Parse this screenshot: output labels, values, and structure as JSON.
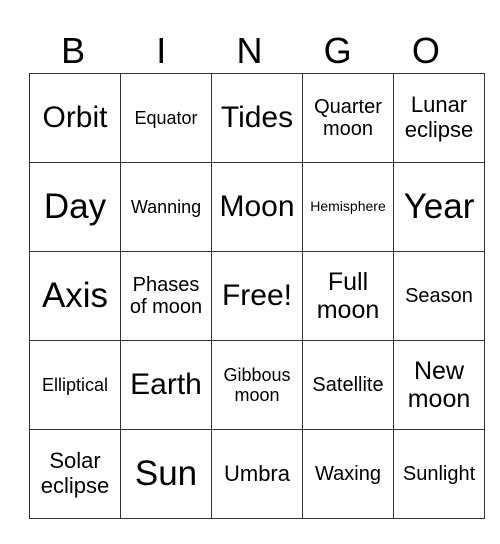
{
  "header": [
    "B",
    "I",
    "N",
    "G",
    "O"
  ],
  "rows": [
    [
      "Orbit",
      "Equator",
      "Tides",
      "Quarter moon",
      "Lunar eclipse"
    ],
    [
      "Day",
      "Wanning",
      "Moon",
      "Hemisphere",
      "Year"
    ],
    [
      "Axis",
      "Phases of moon",
      "Free!",
      "Full moon",
      "Season"
    ],
    [
      "Elliptical",
      "Earth",
      "Gibbous moon",
      "Satellite",
      "New moon"
    ],
    [
      "Solar eclipse",
      "Sun",
      "Umbra",
      "Waxing",
      "Sunlight"
    ]
  ]
}
